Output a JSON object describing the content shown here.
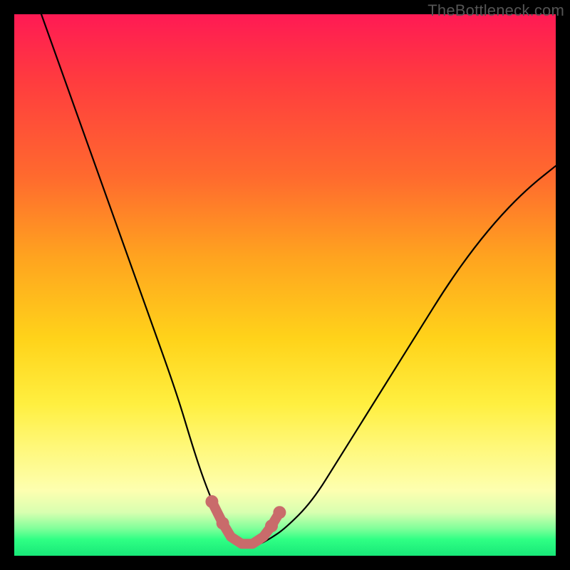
{
  "watermark": "TheBottleneck.com",
  "colors": {
    "background": "#000000",
    "gradient_top": "#ff1a54",
    "gradient_mid": "#ffd31a",
    "gradient_bottom": "#18e878",
    "curve": "#000000",
    "marker": "#c96b6b"
  },
  "chart_data": {
    "type": "line",
    "title": "",
    "xlabel": "",
    "ylabel": "",
    "xlim": [
      0,
      100
    ],
    "ylim": [
      0,
      100
    ],
    "grid": false,
    "legend": false,
    "series": [
      {
        "name": "bottleneck-curve",
        "x": [
          5,
          10,
          15,
          20,
          25,
          30,
          33,
          35,
          37,
          39,
          41,
          43,
          45,
          47,
          50,
          55,
          60,
          65,
          70,
          75,
          80,
          85,
          90,
          95,
          100
        ],
        "values": [
          100,
          86,
          72,
          58,
          44,
          30,
          20,
          14,
          9,
          5,
          3,
          2,
          2,
          3,
          5,
          10,
          18,
          26,
          34,
          42,
          50,
          57,
          63,
          68,
          72
        ]
      }
    ],
    "markers": {
      "name": "trough-markers",
      "x": [
        36.5,
        38.5,
        40,
        42,
        44,
        46,
        47.5,
        49
      ],
      "values": [
        10,
        6,
        3.5,
        2.2,
        2.2,
        3.5,
        5.5,
        8
      ]
    },
    "annotations": []
  }
}
